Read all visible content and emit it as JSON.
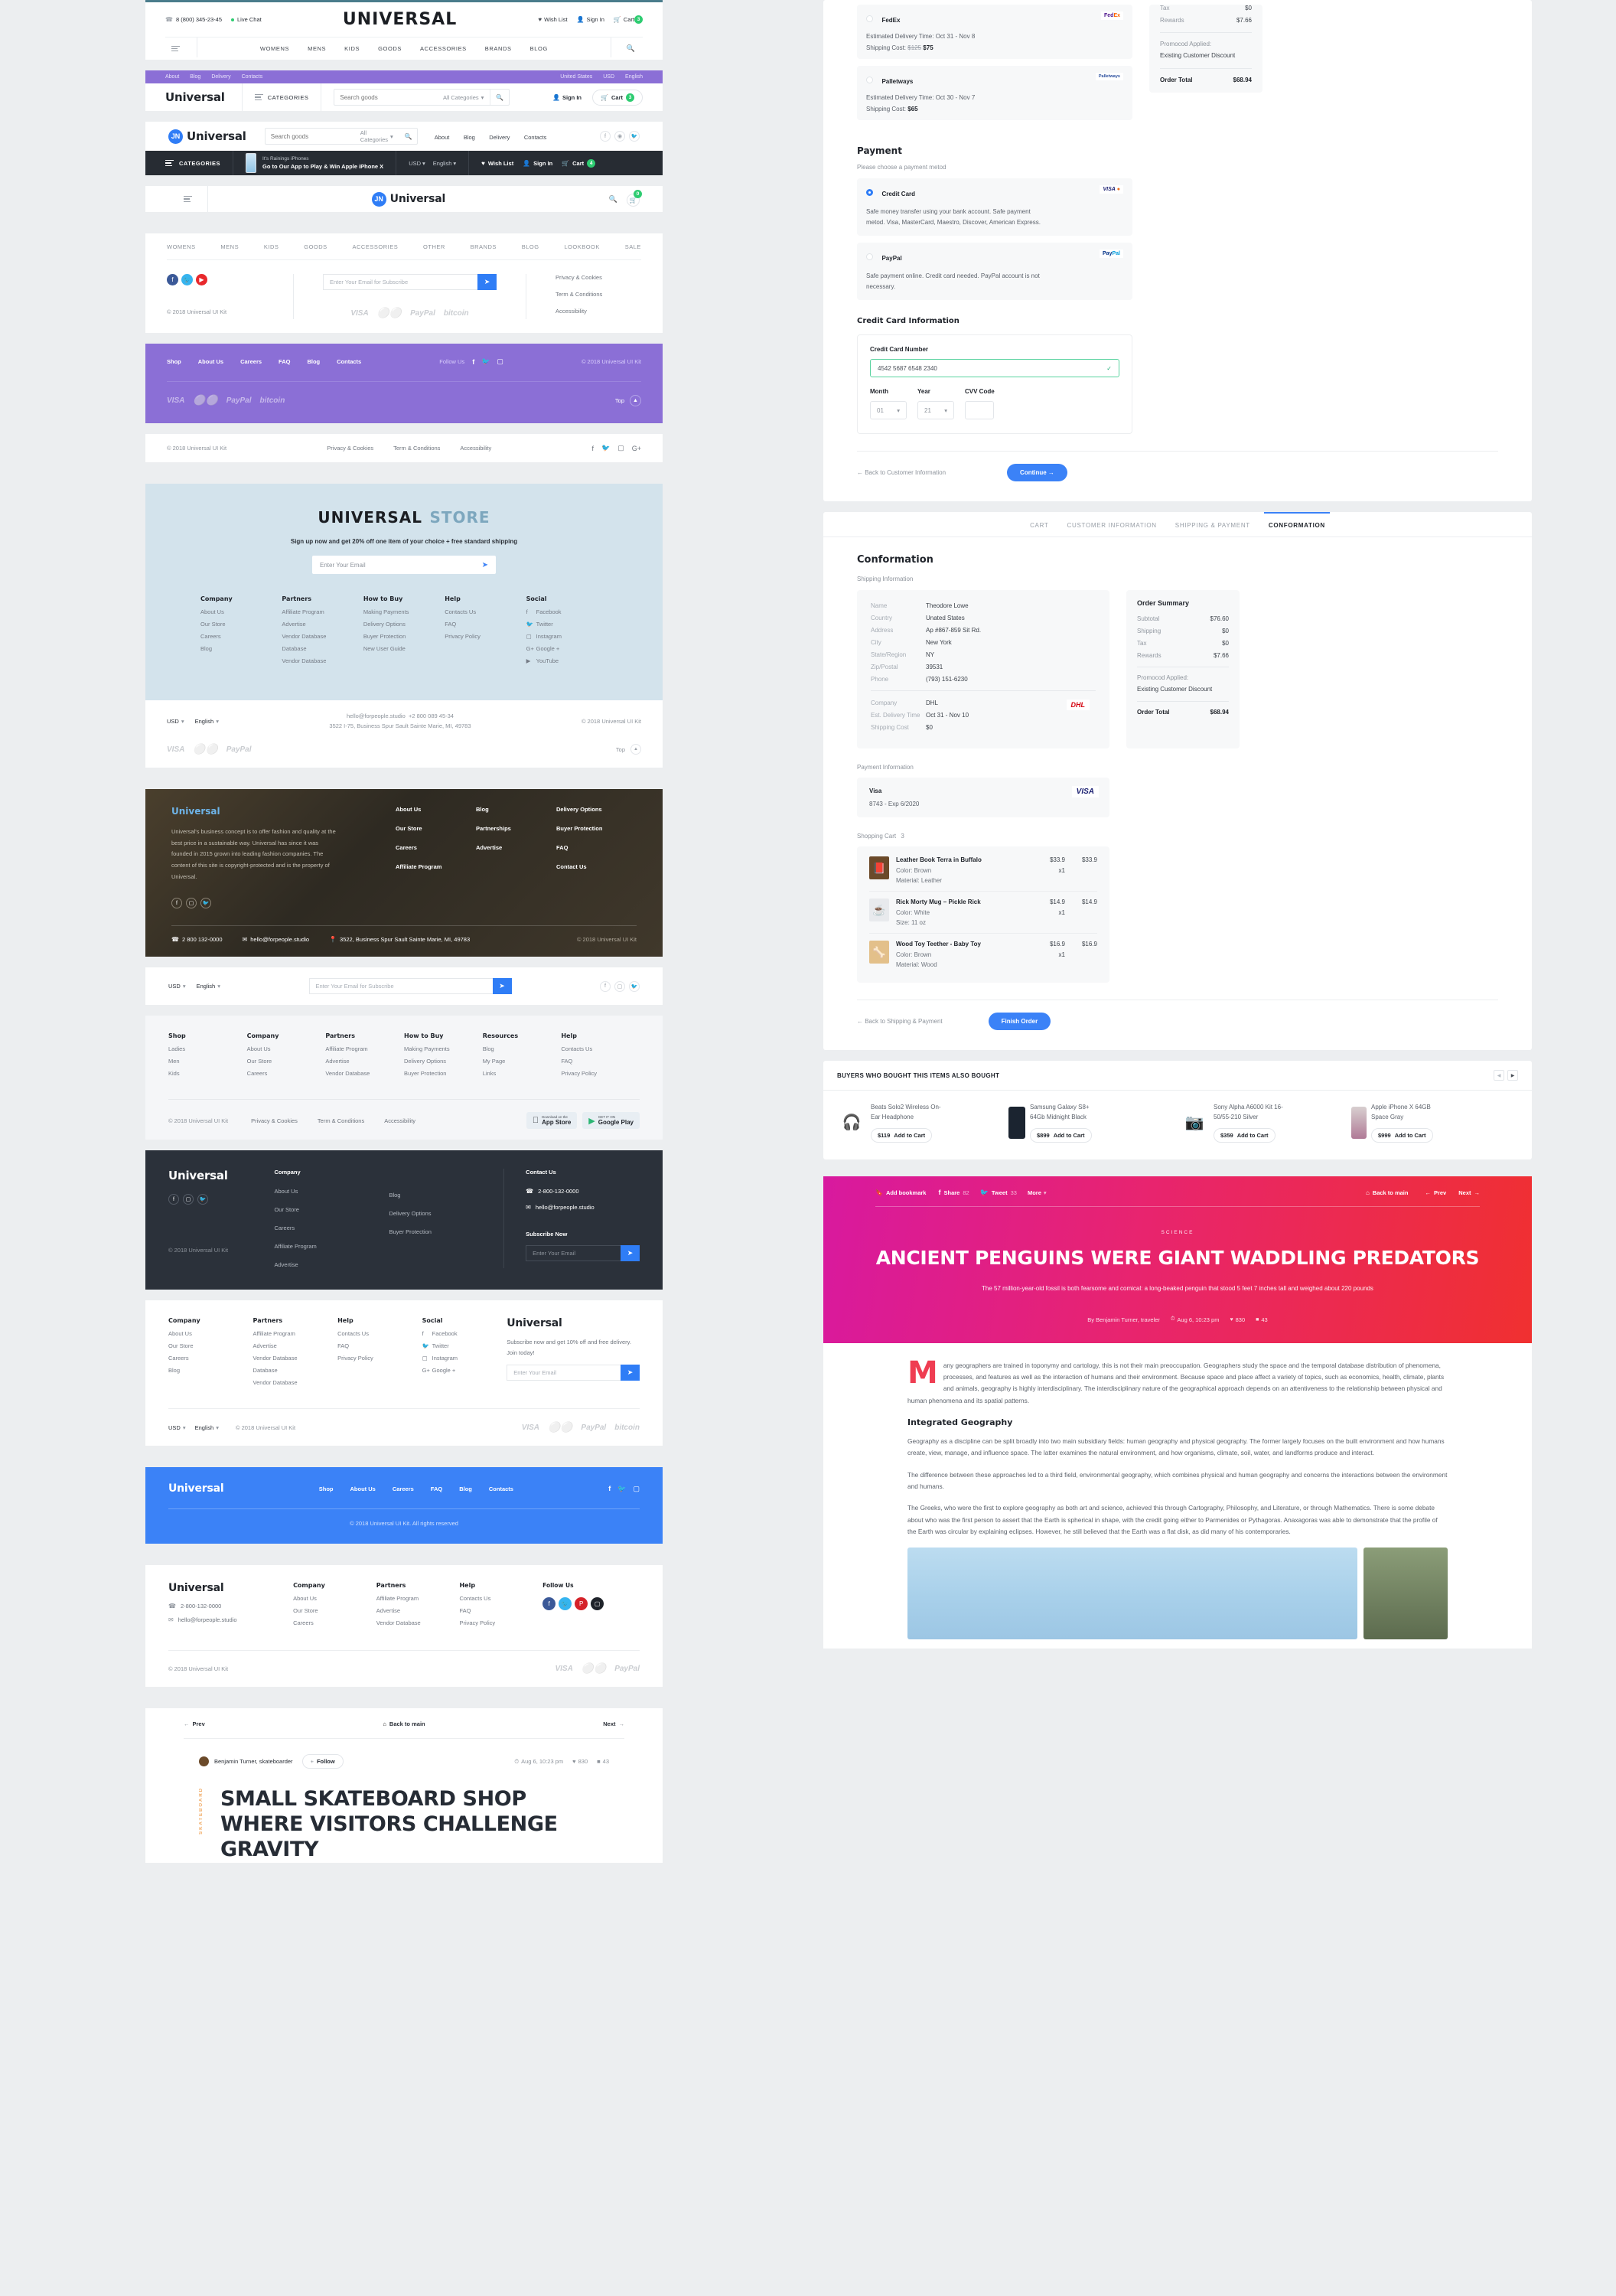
{
  "brand": {
    "name": "Universal",
    "wordmark": "UNIVERSAL",
    "store_suffix": "STORE",
    "copyright": "© 2018 Universal UI Kit"
  },
  "header1": {
    "phone": "8 (800) 345-23-45",
    "live_chat": "Live Chat",
    "wish_list": "Wish List",
    "sign_in": "Sign In",
    "cart": "Cart",
    "cart_count": "3",
    "nav": [
      "WOMENS",
      "MENS",
      "KIDS",
      "GOODS",
      "ACCESSORIES",
      "BRANDS",
      "BLOG"
    ]
  },
  "header2": {
    "top_links": [
      "About",
      "Blog",
      "Delivery",
      "Contacts"
    ],
    "country": "United States",
    "currency": "USD",
    "language": "English",
    "categories": "CATEGORIES",
    "search_placeholder": "Search goods",
    "all_categories": "All Categories",
    "sign_in": "Sign In",
    "cart": "Cart",
    "cart_count": "3"
  },
  "header3": {
    "search_placeholder": "Search goods",
    "all_categories": "All Categories",
    "nav": [
      "About",
      "Blog",
      "Delivery",
      "Contacts"
    ]
  },
  "header4": {
    "categories": "CATEGORIES",
    "promo_small": "It's Rainings iPhones",
    "promo_big": "Go to Our App to Play & Win Apple iPhone X",
    "currency": "USD",
    "language": "English",
    "wish_list": "Wish List",
    "sign_in": "Sign In",
    "cart": "Cart",
    "cart_count": "4"
  },
  "header5": {
    "cart_count": "0"
  },
  "footer1": {
    "nav": [
      "WOMENS",
      "MENS",
      "KIDS",
      "GOODS",
      "ACCESSORIES",
      "OTHER",
      "BRANDS",
      "BLOG",
      "LOOKBOOK",
      "SALE"
    ],
    "subscribe_placeholder": "Enter Your Email for Subscribe",
    "links": [
      "Privacy & Cookies",
      "Term & Conditions",
      "Accessibility"
    ],
    "payments": [
      "VISA",
      "mastercard",
      "PayPal",
      "bitcoin"
    ]
  },
  "footer_purple": {
    "nav": [
      "Shop",
      "About Us",
      "Careers",
      "FAQ",
      "Blog",
      "Contacts"
    ],
    "follow_us": "Follow Us",
    "top": "Top",
    "payments": [
      "VISA",
      "mastercard",
      "PayPal",
      "bitcoin"
    ]
  },
  "footer_thin": {
    "links": [
      "Privacy & Cookies",
      "Term & Conditions",
      "Accessibility"
    ]
  },
  "footer_store": {
    "tagline": "Sign up now and get  20% off one item of your choice + free standard shipping",
    "email_placeholder": "Enter Your Email",
    "columns": [
      {
        "title": "Company",
        "items": [
          "About Us",
          "Our Store",
          "Careers",
          "Blog"
        ]
      },
      {
        "title": "Partners",
        "items": [
          "Affiliate Program",
          "Advertise",
          "Vendor Database",
          "Database",
          "Vendor Database"
        ]
      },
      {
        "title": "How to Buy",
        "items": [
          "Making Payments",
          "Delivery Options",
          "Buyer Protection",
          "New User Guide"
        ]
      },
      {
        "title": "Help",
        "items": [
          "Contacts Us",
          "FAQ",
          "Privacy Policy"
        ]
      },
      {
        "title": "Social",
        "items": [
          "Facebook",
          "Twitter",
          "Instagram",
          "Google +",
          "YouTube"
        ]
      }
    ],
    "currency": "USD",
    "language": "English",
    "contact_email": "hello@forpeople.studio",
    "contact_phone": "+2 800 089 45-34",
    "contact_address": "3522 I-75, Business Spur Sault Sainte Marie, MI, 49783",
    "top": "Top"
  },
  "footer_photo": {
    "about": "Universal's business concept is to offer fashion and quality at the best price in a sustainable way. Universal has since it was founded in 2015 grown into leading fashion companies. The content of this site is copyright-protected and is the property of Universal.",
    "cols": [
      [
        "About Us",
        "Our Store",
        "Careers",
        "Affiliate Program"
      ],
      [
        "Blog",
        "Partnerships",
        "Advertise"
      ],
      [
        "Delivery Options",
        "Buyer Protection",
        "FAQ",
        "Contact Us"
      ]
    ],
    "phone": "2 800 132-0000",
    "email": "hello@forpeople.studio",
    "address": "3522, Business Spur Sault Sainte Marie, MI, 49783"
  },
  "footer_big": {
    "currency": "USD",
    "language": "English",
    "subscribe_placeholder": "Enter Your Email for Subscribe",
    "columns": [
      {
        "title": "Shop",
        "items": [
          "Ladies",
          "Men",
          "Kids"
        ]
      },
      {
        "title": "Company",
        "items": [
          "About Us",
          "Our Store",
          "Careers"
        ]
      },
      {
        "title": "Partners",
        "items": [
          "Affiliate Program",
          "Advertise",
          "Vendor Database"
        ]
      },
      {
        "title": "How to Buy",
        "items": [
          "Making Payments",
          "Delivery Options",
          "Buyer Protection"
        ]
      },
      {
        "title": "Resources",
        "items": [
          "Blog",
          "My Page",
          "Links"
        ]
      },
      {
        "title": "Help",
        "items": [
          "Contacts Us",
          "FAQ",
          "Privacy Policy"
        ]
      }
    ],
    "legal": [
      "Privacy & Cookies",
      "Term & Conditions",
      "Accessibility"
    ],
    "app_store": "App Store",
    "app_store_sub": "Download on the",
    "google_play": "Google Play",
    "google_play_sub": "GET IT ON"
  },
  "footer_dark": {
    "company_title": "Company",
    "col_a": [
      "About Us",
      "Our Store",
      "Careers",
      "Affiliate Program",
      "Advertise"
    ],
    "col_b": [
      "Blog",
      "Delivery Options",
      "Buyer Protection"
    ],
    "contact_title": "Contact Us",
    "phone": "2-800-132-0000",
    "email": "hello@forpeople.studio",
    "subscribe_title": "Subscribe Now",
    "subscribe_placeholder": "Enter Your Email"
  },
  "footer_sub": {
    "columns": [
      {
        "title": "Company",
        "items": [
          "About Us",
          "Our Store",
          "Careers",
          "Blog"
        ]
      },
      {
        "title": "Partners",
        "items": [
          "Affiliate Program",
          "Advertise",
          "Vendor Database",
          "Database",
          "Vendor Database"
        ]
      },
      {
        "title": "Help",
        "items": [
          "Contacts Us",
          "FAQ",
          "Privacy Policy"
        ]
      },
      {
        "title": "Social",
        "items": [
          "Facebook",
          "Twitter",
          "Instagram",
          "Google +"
        ]
      }
    ],
    "promo": "Subscribe now and get 10% off and free delivery. Join today!",
    "email_placeholder": "Enter Your Email",
    "currency": "USD",
    "language": "English"
  },
  "footer_blue": {
    "nav": [
      "Shop",
      "About Us",
      "Careers",
      "FAQ",
      "Blog",
      "Contacts"
    ],
    "copyright": "© 2018 Universal UI Kit. All rights reserved"
  },
  "footer_last": {
    "phone": "2-800-132-0000",
    "email": "hello@forpeople.studio",
    "columns": [
      {
        "title": "Company",
        "items": [
          "About Us",
          "Our Store",
          "Careers"
        ]
      },
      {
        "title": "Partners",
        "items": [
          "Affiliate Program",
          "Advertise",
          "Vendor Database"
        ]
      },
      {
        "title": "Help",
        "items": [
          "Contacts Us",
          "FAQ",
          "Privacy Policy"
        ]
      }
    ],
    "follow_us": "Follow Us"
  },
  "skate_article": {
    "prev": "Prev",
    "back": "Back to main",
    "next": "Next",
    "author": "Benjamin Turner, skateboarder",
    "follow": "Follow",
    "date": "Aug 6, 10:23 pm",
    "likes": "830",
    "comments": "43",
    "category": "SKATEBOARD",
    "title": "SMALL SKATEBOARD SHOP WHERE VISITORS CHALLENGE GRAVITY"
  },
  "checkout": {
    "shipping_options": [
      {
        "name": "FedEx",
        "eta_label": "Estimated Delivery Time:",
        "eta": "Oct 31 - Nov 8",
        "cost_label": "Shipping Cost:",
        "cost_old": "$125",
        "cost": "$75",
        "logo": "FedEx"
      },
      {
        "name": "Palletways",
        "eta_label": "Estimated Delivery Time:",
        "eta": "Oct 30 - Nov 7",
        "cost_label": "Shipping Cost:",
        "cost_old": "",
        "cost": "$65",
        "logo": "Palletways"
      }
    ],
    "summary_top": {
      "rows": [
        {
          "k": "Tax",
          "v": "$0"
        },
        {
          "k": "Rewards",
          "v": "$7.66"
        }
      ],
      "promo_label": "Promocod Applied:",
      "promo_value": "Existing Customer Discount",
      "total_label": "Order Total",
      "total_value": "$68.94"
    },
    "payment_title": "Payment",
    "payment_sub": "Please choose a payment metod",
    "payment_methods": [
      {
        "name": "Credit Card",
        "desc": "Safe money transfer using your bank account. Safe payment metod. Visa, MasterCard, Maestro, Discover, American Express.",
        "logo": "VISA",
        "selected": true
      },
      {
        "name": "PayPal",
        "desc": "Safe payment online. Credit card needed. PayPal account is not necessary.",
        "logo": "PayPal",
        "selected": false
      }
    ],
    "cc_title": "Credit Card Information",
    "cc_number_label": "Credit Card Number",
    "cc_number_value": "4542 5687 6548 2340",
    "month_label": "Month",
    "month_value": "01",
    "year_label": "Year",
    "year_value": "21",
    "cvv_label": "CVV Code",
    "cvv_value": "",
    "back_label": "← Back to Customer Information",
    "continue_label": "Continue  →"
  },
  "confirmation": {
    "tabs": [
      "CART",
      "CUSTOMER INFORMATION",
      "SHIPPING & PAYMENT",
      "CONFORMATION"
    ],
    "active_tab": "CONFORMATION",
    "title": "Conformation",
    "shipping_info_label": "Shipping Information",
    "fields": [
      {
        "k": "Name",
        "v": "Theodore Lowe"
      },
      {
        "k": "Country",
        "v": "Unated States"
      },
      {
        "k": "Address",
        "v": "Ap #867-859 Sit Rd."
      },
      {
        "k": "City",
        "v": "New York"
      },
      {
        "k": "State/Region",
        "v": "NY"
      },
      {
        "k": "Zip/Postal",
        "v": "39531"
      },
      {
        "k": "Phone",
        "v": "(793) 151-6230"
      }
    ],
    "ship_fields": [
      {
        "k": "Company",
        "v": "DHL"
      },
      {
        "k": "Est. Delivery Time",
        "v": "Oct 31 - Nov 10"
      },
      {
        "k": "Shipping Cost",
        "v": "$0"
      }
    ],
    "ship_logo": "DHL",
    "order_summary_title": "Order Summary",
    "summary_rows": [
      {
        "k": "Subtotal",
        "v": "$76.60"
      },
      {
        "k": "Shipping",
        "v": "$0"
      },
      {
        "k": "Tax",
        "v": "$0"
      },
      {
        "k": "Rewards",
        "v": "$7.66"
      }
    ],
    "promo_label": "Promocod Applied:",
    "promo_value": "Existing Customer Discount",
    "total_label": "Order Total",
    "total_value": "$68.94",
    "payment_info_label": "Payment Information",
    "card_name": "Visa",
    "card_detail": "8743 - Exp 6/2020",
    "card_logo": "VISA",
    "cart_label": "Shopping Cart",
    "cart_count": "3",
    "cart_items": [
      {
        "name": "Leather Book Terra in Buffalo",
        "a1": "Color: Brown",
        "a2": "Material: Leather",
        "price": "$33.9",
        "qty": "x1",
        "total": "$33.9",
        "glyph": "📕"
      },
      {
        "name": "Rick Morty Mug – Pickle Rick",
        "a1": "Color: White",
        "a2": "Size: 11 oz",
        "price": "$14.9",
        "qty": "x1",
        "total": "$14.9",
        "glyph": "🥛"
      },
      {
        "name": "Wood Toy Teether - Baby Toy",
        "a1": "Color: Brown",
        "a2": "Material: Wood",
        "price": "$16.9",
        "qty": "x1",
        "total": "$16.9",
        "glyph": "🦴"
      }
    ],
    "back_label": "← Back to Shipping & Payment",
    "finish_label": "Finish Order"
  },
  "also_bought": {
    "title": "BUYERS WHO BOUGHT THIS ITEMS ALSO BOUGHT",
    "products": [
      {
        "name": "Beats Solo2 Wireless On-Ear Headphone",
        "price": "$119",
        "cta": "Add to Cart",
        "glyph": "🎧"
      },
      {
        "name": "Samsung Galaxy S8+ 64Gb Midnight Black",
        "price": "$899",
        "cta": "Add to Cart",
        "glyph": "📱"
      },
      {
        "name": "Sony Alpha A6000 Kit 16-50/55-210 Silver",
        "price": "$359",
        "cta": "Add to Cart",
        "glyph": "📷"
      },
      {
        "name": "Apple iPhone X 64GB Space Gray",
        "price": "$999",
        "cta": "Add to Cart",
        "glyph": "📱"
      }
    ]
  },
  "penguin_article": {
    "bookmark": "Add bookmark",
    "share": "Share",
    "share_count": "82",
    "tweet": "Tweet",
    "tweet_count": "33",
    "more": "More",
    "back": "Back to main",
    "prev": "Prev",
    "next": "Next",
    "category": "SCIENCE",
    "title": "ANCIENT PENGUINS WERE GIANT WADDLING PREDATORS",
    "subtitle": "The 57 million-year-old fossil is both fearsome and comical: a long-beaked penguin that stood 5 feet 7 inches tall and weighed about 220 pounds",
    "byline": "By Benjamin Turner, traveler",
    "date": "Aug 6, 10:23 pm",
    "likes": "830",
    "comments": "43",
    "dropcap": "M",
    "para1": "any geographers are trained in toponymy and cartology, this is not their main preoccupation. Geographers study the space and the temporal database distribution of phenomena, processes, and features as well as the interaction of humans and their environment. Because space and place affect a variety of topics, such as economics, health, climate, plants and animals, geography is highly interdisciplinary. The interdisciplinary nature of the geographical approach depends on an attentiveness to the relationship between physical and human phenomena and its spatial patterns.",
    "heading2": "Integrated Geography",
    "para2": "Geography as a discipline can be split broadly into two main subsidiary fields: human geography and physical geography. The former largely focuses on the built environment and how humans create, view, manage, and influence space. The latter examines the natural environment, and how organisms, climate, soil, water, and landforms produce and interact.",
    "para3": "The difference between these approaches led to a third field, environmental geography, which combines physical and human geography and concerns the interactions between the environment and humans.",
    "para4": "The Greeks, who were the first to explore geography as both art and science, achieved this through Cartography, Philosophy, and Literature, or through Mathematics. There is some debate about who was the first person to assert that the Earth is spherical in shape, with the credit going either to Parmenides or Pythagoras. Anaxagoras was able to demonstrate that the profile of the Earth was circular by explaining eclipses. However, he still believed that the Earth was a flat disk, as did many of his contemporaries."
  },
  "colors": {
    "accent_blue": "#3b82f7",
    "purple": "#8b6fd6",
    "dark": "#272c33",
    "light_blue_bg": "#d3e3ec",
    "green": "#2ecc71",
    "hero_pink": "#d8199f",
    "hero_red": "#f03030"
  }
}
